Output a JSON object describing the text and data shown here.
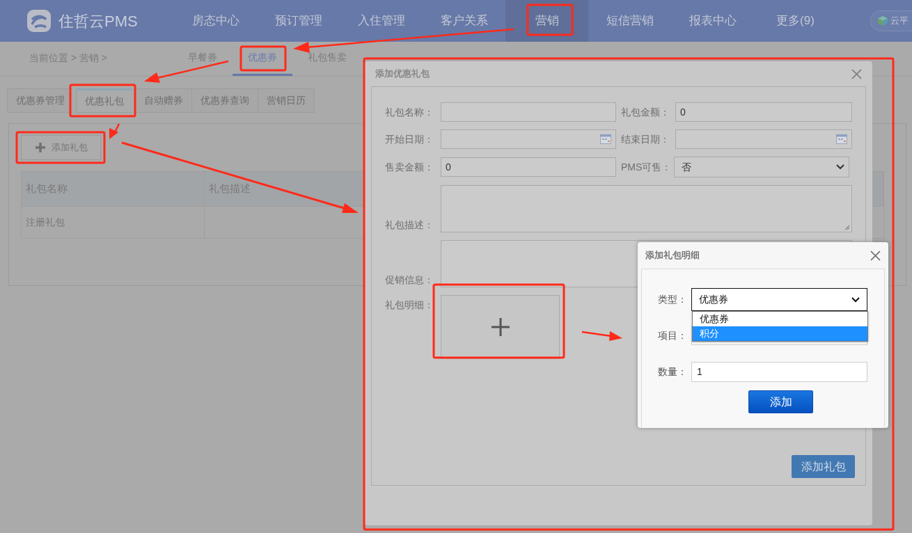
{
  "logo": {
    "name": "住哲云PMS"
  },
  "nav": [
    {
      "label": "房态中心",
      "selected": false
    },
    {
      "label": "预订管理",
      "selected": false
    },
    {
      "label": "入住管理",
      "selected": false
    },
    {
      "label": "客户关系",
      "selected": false
    },
    {
      "label": "营销",
      "selected": true
    },
    {
      "label": "短信营销",
      "selected": false
    },
    {
      "label": "报表中心",
      "selected": false
    },
    {
      "label": "更多(9)",
      "selected": false
    }
  ],
  "nav_badge": "云平",
  "breadcrumb": "当前位置 > 营销 >",
  "sub_nav": [
    {
      "label": "早餐券",
      "selected": false
    },
    {
      "label": "优惠券",
      "selected": true
    },
    {
      "label": "礼包售卖",
      "selected": false
    }
  ],
  "tabs": [
    {
      "label": "优惠券管理",
      "selected": false
    },
    {
      "label": "优惠礼包",
      "selected": true
    },
    {
      "label": "自动赠券",
      "selected": false
    },
    {
      "label": "优惠券查询",
      "selected": false
    },
    {
      "label": "营销日历",
      "selected": false
    }
  ],
  "add_button": "添加礼包",
  "table": {
    "columns": [
      "礼包名称",
      "礼包描述"
    ],
    "rows": [
      {
        "name": "注册礼包"
      }
    ]
  },
  "dialog": {
    "title": "添加优惠礼包",
    "fields": [
      {
        "kind": "text",
        "label": "礼包名称："
      },
      {
        "kind": "text",
        "label": "礼包金额：",
        "value": "0"
      },
      {
        "kind": "date",
        "label": "开始日期："
      },
      {
        "kind": "date",
        "label": "结束日期："
      },
      {
        "kind": "text",
        "label": "售卖金额：",
        "value": "0"
      },
      {
        "kind": "select",
        "label": "PMS可售：",
        "value": "否"
      },
      {
        "kind": "textarea",
        "label": "礼包描述：",
        "resize_handle": true
      },
      {
        "kind": "textarea",
        "label": "促销信息："
      },
      {
        "kind": "tile",
        "label": "礼包明细："
      }
    ],
    "submit": "添加礼包"
  },
  "detail_dialog": {
    "title": "添加礼包明细",
    "type_label": "类型：",
    "type_value": "优惠券",
    "options": [
      {
        "label": "优惠券",
        "selected": false
      },
      {
        "label": "积分",
        "selected": true
      }
    ],
    "item_label": "项目：",
    "qty_label": "数量：",
    "qty_value": "1",
    "button": "添加"
  }
}
